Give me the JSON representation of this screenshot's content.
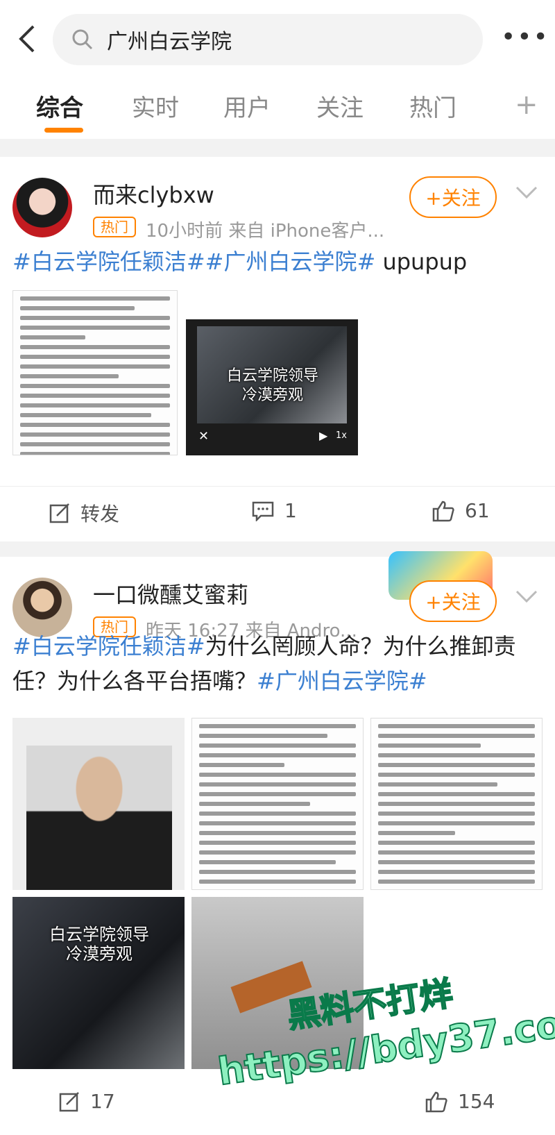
{
  "search": {
    "query": "广州白云学院"
  },
  "tabs": [
    "综合",
    "实时",
    "用户",
    "关注",
    "热门"
  ],
  "posts": [
    {
      "username": "而来clybxw",
      "badge": "热门",
      "meta": "10小时前   来自 iPhone客户...",
      "follow": "+关注",
      "tag1": "#白云学院任颖洁#",
      "tag2": "#广州白云学院#",
      "text_after": " upupup",
      "image2_caption": "白云学院领导\n冷漠旁观",
      "video_speed": "1x",
      "repost": "转发",
      "comments": "1",
      "likes": "61"
    },
    {
      "username": "一口微醺艾蜜莉",
      "badge": "热门",
      "meta": "昨天 16:27   来自 Andro...",
      "follow": "+关注",
      "tag1": "#白云学院任颖洁#",
      "text_mid": "为什么罔顾人命？为什么推卸责任？为什么各平台捂嘴？",
      "tag2": "#广州白云学院#",
      "image_caption": "白云学院领导\n冷漠旁观",
      "repost_count": "17",
      "likes": "154"
    }
  ],
  "watermark": {
    "line1": "黑料不打烊",
    "line2": "https://bdy37.co"
  }
}
